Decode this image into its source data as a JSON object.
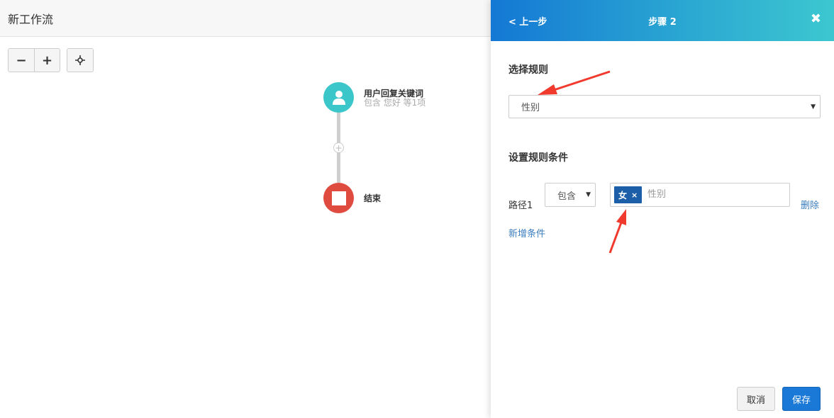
{
  "app": {
    "title": "新工作流"
  },
  "toolbar": {
    "zoom_out": "−",
    "zoom_in": "+",
    "center": "⌖"
  },
  "flow": {
    "start_node": {
      "title": "用户回复关键词",
      "subtitle": "包含 您好 等1项"
    },
    "add_step": "+",
    "end_node": {
      "title": "结束"
    }
  },
  "panel": {
    "back_label": "< 上一步",
    "title": "步骤 2",
    "close_label": "✖",
    "rule_section_label": "选择规则",
    "rule_select_value": "性别",
    "condition_section_label": "设置规则条件",
    "path_label": "路径1",
    "operator_value": "包含",
    "tag_value": "女",
    "tag_remove": "×",
    "tag_placeholder": "性别",
    "delete_label": "删除",
    "add_condition_label": "新增条件",
    "cancel_label": "取消",
    "save_label": "保存"
  },
  "colors": {
    "header_gradient_start": "#1478d4",
    "header_gradient_end": "#3cc7d0",
    "start_node": "#3bc6c9",
    "end_node": "#df4b3e",
    "tag": "#1c5fa8",
    "save_button": "#1a78d6",
    "annotation_arrow": "#f03a2e"
  }
}
